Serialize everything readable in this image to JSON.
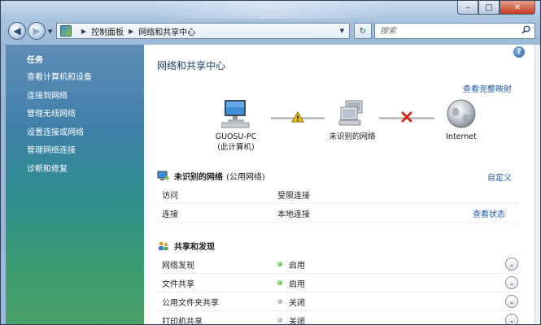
{
  "window": {
    "min": "–",
    "max": "□",
    "close": "✕"
  },
  "nav": {
    "back": "◀",
    "forward": "▶",
    "dropdown": "▼",
    "refresh": "↻"
  },
  "address": {
    "crumbs": [
      "控制面板",
      "网络和共享中心"
    ],
    "separator": "▶",
    "dropdown": "▼"
  },
  "search": {
    "placeholder": "搜索",
    "icon": "search-icon"
  },
  "sidebar": {
    "title": "任务",
    "items": [
      "查看计算机和设备",
      "连接到网络",
      "管理无线网络",
      "设置连接或网络",
      "管理网络连接",
      "诊断和修复"
    ]
  },
  "main": {
    "help": "?",
    "title": "网络和共享中心",
    "view_full_map": "查看完整映射",
    "map": {
      "computer_name": "GUOSU-PC",
      "computer_sub": "(此计算机)",
      "network_label": "未识别的网络",
      "internet_label": "Internet",
      "link1_status": "warning",
      "link2_status": "disconnected"
    },
    "network": {
      "name": "未识别的网络",
      "type": "(公用网络)",
      "customize": "自定义",
      "rows": [
        {
          "key": "访问",
          "value": "受限连接"
        },
        {
          "key": "连接",
          "value": "本地连接",
          "link": "查看状态"
        }
      ]
    },
    "sharing": {
      "title": "共享和发现",
      "rows": [
        {
          "key": "网络发现",
          "value": "启用",
          "state": "on"
        },
        {
          "key": "文件共享",
          "value": "启用",
          "state": "on"
        },
        {
          "key": "公用文件夹共享",
          "value": "关闭",
          "state": "off"
        },
        {
          "key": "打印机共享",
          "value": "关闭",
          "state": "off"
        }
      ],
      "expand_glyph": "⌄"
    }
  },
  "colors": {
    "accent": "#1a5aa8",
    "sidebar_top": "#5e8cb8",
    "sidebar_bottom": "#4aa169",
    "on": "#2e9b1f",
    "off": "#8c8c8c"
  }
}
